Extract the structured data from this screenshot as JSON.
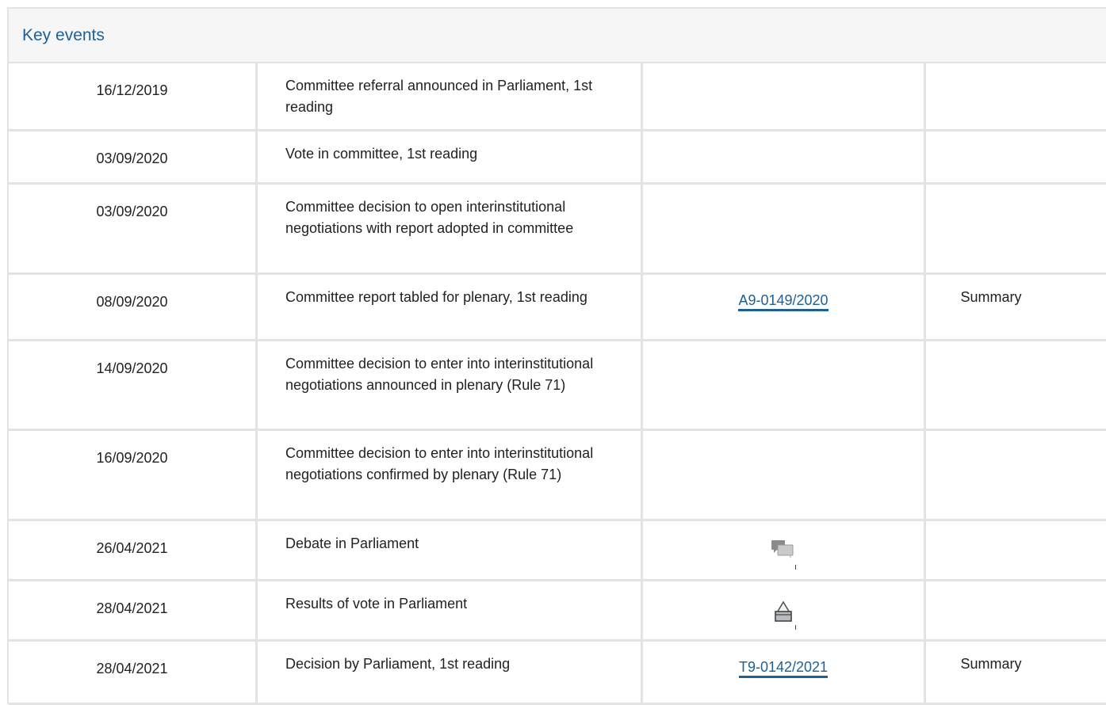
{
  "panel": {
    "title": "Key events"
  },
  "events": [
    {
      "date": "16/12/2019",
      "event": "Committee referral announced in Parliament, 1st reading",
      "doc": "",
      "summary": ""
    },
    {
      "date": "03/09/2020",
      "event": "Vote in committee, 1st reading",
      "doc": "",
      "summary": ""
    },
    {
      "date": "03/09/2020",
      "event": "Committee decision to open interinstitutional negotiations with report adopted in committee",
      "doc": "",
      "summary": ""
    },
    {
      "date": "08/09/2020",
      "event": "Committee report tabled for plenary, 1st reading",
      "doc": "A9-0149/2020",
      "summary": "Summary"
    },
    {
      "date": "14/09/2020",
      "event": "Committee decision to enter into interinstitutional negotiations announced in plenary (Rule 71)",
      "doc": "",
      "summary": ""
    },
    {
      "date": "16/09/2020",
      "event": "Committee decision to enter into interinstitutional negotiations confirmed by plenary (Rule 71)",
      "doc": "",
      "summary": ""
    },
    {
      "date": "26/04/2021",
      "event": "Debate in Parliament",
      "doc_icon": "debate-icon",
      "summary": ""
    },
    {
      "date": "28/04/2021",
      "event": "Results of vote in Parliament",
      "doc_icon": "vote-icon",
      "summary": ""
    },
    {
      "date": "28/04/2021",
      "event": "Decision by Parliament, 1st reading",
      "doc": "T9-0142/2021",
      "summary": "Summary"
    }
  ],
  "colors": {
    "accent": "#1f5f98",
    "border": "#e3e3e3",
    "header_bg": "#f6f6f6"
  }
}
